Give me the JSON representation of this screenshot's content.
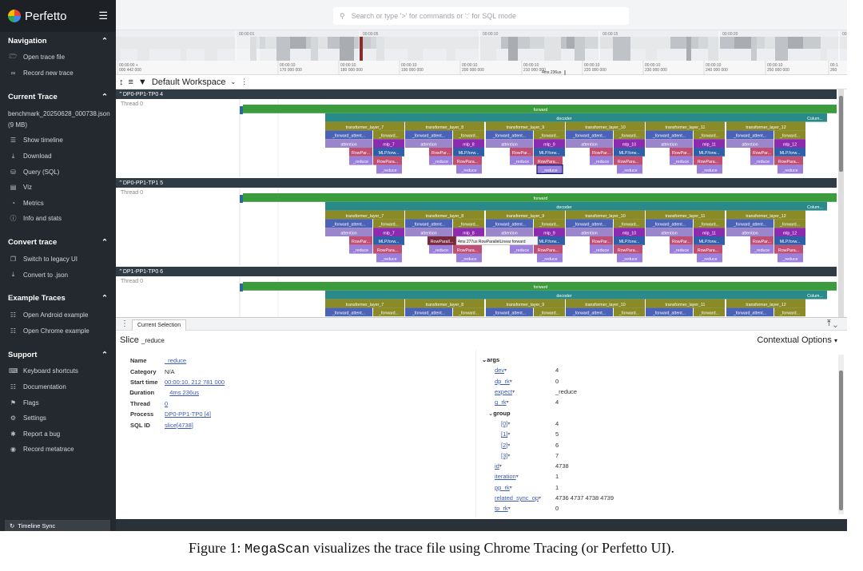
{
  "app": {
    "name": "Perfetto"
  },
  "search": {
    "placeholder": "Search or type '>' for commands or ':' for SQL mode"
  },
  "sidebar": {
    "sections": [
      {
        "title": "Navigation",
        "items": [
          {
            "icon": "folder-open-icon",
            "label": "Open trace file"
          },
          {
            "icon": "link-icon",
            "label": "Record new trace"
          }
        ]
      },
      {
        "title": "Current Trace",
        "trace_file": "benchmark_20250628_000738.json (9 MB)",
        "items": [
          {
            "icon": "timeline-icon",
            "label": "Show timeline"
          },
          {
            "icon": "download-icon",
            "label": "Download"
          },
          {
            "icon": "database-icon",
            "label": "Query (SQL)"
          },
          {
            "icon": "viz-icon",
            "label": "Viz"
          },
          {
            "icon": "speed-icon",
            "label": "Metrics"
          },
          {
            "icon": "info-icon",
            "label": "Info and stats"
          }
        ]
      },
      {
        "title": "Convert trace",
        "items": [
          {
            "icon": "switch-icon",
            "label": "Switch to legacy UI"
          },
          {
            "icon": "download-icon",
            "label": "Convert to .json"
          }
        ]
      },
      {
        "title": "Example Traces",
        "items": [
          {
            "icon": "document-icon",
            "label": "Open Android example"
          },
          {
            "icon": "document-icon",
            "label": "Open Chrome example"
          }
        ]
      },
      {
        "title": "Support",
        "items": [
          {
            "icon": "keyboard-icon",
            "label": "Keyboard shortcuts"
          },
          {
            "icon": "documentation-icon",
            "label": "Documentation"
          },
          {
            "icon": "flag-icon",
            "label": "Flags"
          },
          {
            "icon": "gear-icon",
            "label": "Settings"
          },
          {
            "icon": "bug-icon",
            "label": "Report a bug"
          },
          {
            "icon": "record-icon",
            "label": "Record metatrace"
          }
        ]
      }
    ],
    "timeline_sync": "Timeline Sync"
  },
  "overview": {
    "labels": [
      "00:00:01",
      "00:00:05",
      "00:00:10",
      "00:00:15",
      "00:00:20",
      "00:00:25"
    ]
  },
  "ruler": {
    "ticks": [
      {
        "t": "00:00:00 +",
        "ns": "000 442 000"
      },
      {
        "t": "00:00:10",
        "ns": "170 000 000"
      },
      {
        "t": "00:00:10",
        "ns": "180 000 000"
      },
      {
        "t": "00:00:10",
        "ns": "190 000 000"
      },
      {
        "t": "00:00:10",
        "ns": "200 000 000"
      },
      {
        "t": "00:00:10",
        "ns": "210 000 000"
      },
      {
        "t": "00:00:10",
        "ns": "220 000 000"
      },
      {
        "t": "00:00:10",
        "ns": "230 000 000"
      },
      {
        "t": "00:00:10",
        "ns": "240 000 000"
      },
      {
        "t": "00:00:10",
        "ns": "250 000 000"
      },
      {
        "t": "00:1",
        "ns": "260"
      }
    ],
    "marker": "4ms 236us"
  },
  "workspace": {
    "title": "Default Workspace"
  },
  "tracks": [
    {
      "process": "DP0-PP1-TP0 4",
      "thread": "Thread 0"
    },
    {
      "process": "DP0-PP1-TP1 5",
      "thread": "Thread 0"
    },
    {
      "process": "DP1-PP1-TP0 6",
      "thread": "Thread 0"
    }
  ],
  "slices": {
    "forward": "forward",
    "decoder": "decoder",
    "column": "Colum...",
    "layers": [
      "transformer_layer_7",
      "transformer_layer_8",
      "transformer_layer_9",
      "transformer_layer_10",
      "transformer_layer_11",
      "transformer_layer_12"
    ],
    "attn_fwd": "_forward_attent...",
    "fwd_short": "_forward...",
    "attention": "attention",
    "mlps": [
      "mlp_7",
      "mlp_8",
      "mlp_9",
      "mlp_10",
      "mlp_11",
      "mlp_12"
    ],
    "rowpar": "RowPar...",
    "mlp_fwd": "MLP.forw...",
    "reduce": "_reduce",
    "rowpara": "RowPara...",
    "tooltip": "4ms 277us RowParallelLinear forward",
    "rowparallel": "RowParall..."
  },
  "panel": {
    "tab": "Current Selection",
    "slice_label": "Slice",
    "slice_name": "_reduce",
    "contextual": "Contextual Options",
    "details": [
      {
        "key": "Name",
        "value": "_reduce",
        "link": true
      },
      {
        "key": "Category",
        "value": "N/A",
        "link": false
      },
      {
        "key": "Start time",
        "value": "00:00:10. 212 781 000",
        "link": true
      },
      {
        "key": "Duration",
        "value": "4ms 236us",
        "link": true
      },
      {
        "key": "Thread",
        "value": "0",
        "link": true
      },
      {
        "key": "Process",
        "value": "DP0-PP1-TP0 [4]",
        "link": true
      },
      {
        "key": "SQL ID",
        "value": "slice[4738]",
        "link": true
      }
    ],
    "args_title": "args",
    "args": [
      {
        "key": "dev",
        "value": "4",
        "indent": 1
      },
      {
        "key": "dp_rk",
        "value": "0",
        "indent": 1
      },
      {
        "key": "expect",
        "value": "_reduce",
        "indent": 1
      },
      {
        "key": "g_rk",
        "value": "4",
        "indent": 1
      },
      {
        "key": "group",
        "value": "",
        "indent": 1,
        "group": true
      },
      {
        "key": "[0]",
        "value": "4",
        "indent": 2
      },
      {
        "key": "[1]",
        "value": "5",
        "indent": 2
      },
      {
        "key": "[2]",
        "value": "6",
        "indent": 2
      },
      {
        "key": "[3]",
        "value": "7",
        "indent": 2
      },
      {
        "key": "id",
        "value": "4738",
        "indent": 1
      },
      {
        "key": "iteration",
        "value": "1",
        "indent": 1
      },
      {
        "key": "pp_rk",
        "value": "1",
        "indent": 1
      },
      {
        "key": "related_sync_op",
        "value": "4736 4737 4738 4739",
        "indent": 1
      },
      {
        "key": "tp_rk",
        "value": "0",
        "indent": 1
      }
    ]
  },
  "caption": {
    "prefix": "Figure 1: ",
    "tool": "MegaScan",
    "rest": " visualizes the trace file using Chrome Tracing (or Perfetto UI)."
  },
  "colors": {
    "sidebar": "#24292f",
    "forward": "#3b9b3d",
    "decoder": "#2a8a8a",
    "layer": "#8a8a27",
    "attn": "#4a63b6",
    "attention": "#9b86cc",
    "mlp": "#8d2bb0",
    "rowpar": "#c04f76",
    "mlpfwd": "#2e5fa8",
    "reduce": "#9a7fdc",
    "selected": "#1a44c8"
  }
}
